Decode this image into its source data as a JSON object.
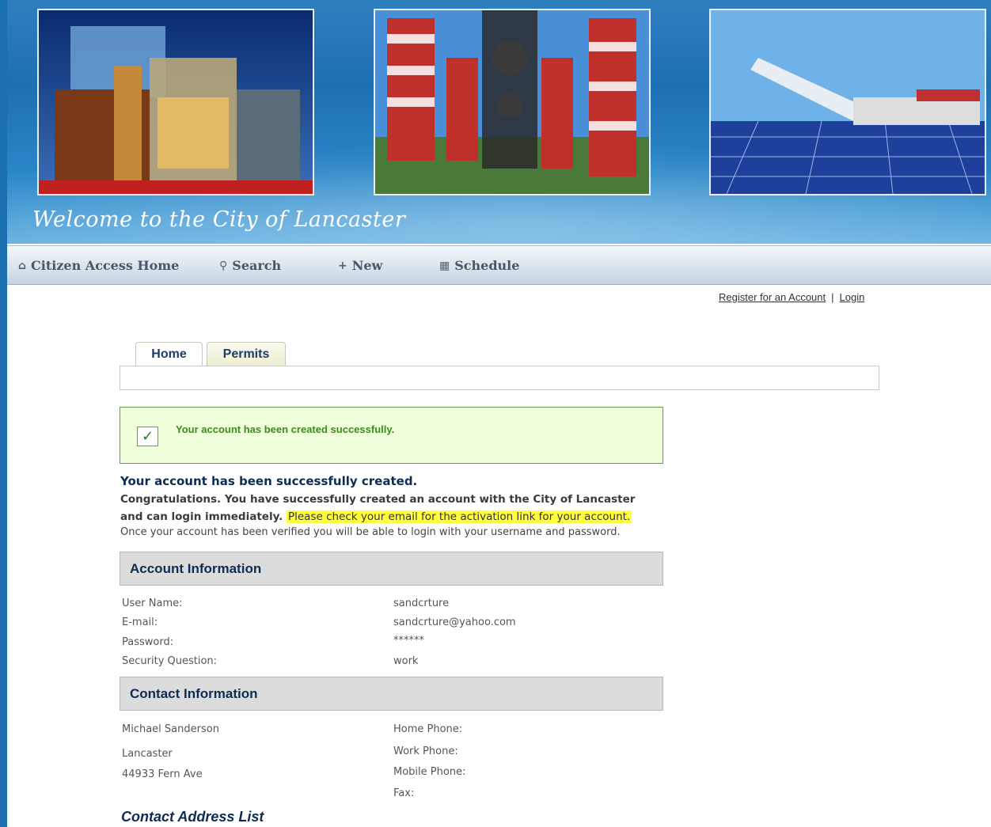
{
  "banner": {
    "welcome_text": "Welcome to the City of Lancaster"
  },
  "nav": {
    "items": [
      {
        "label": "Citizen Access Home",
        "icon": "home-icon"
      },
      {
        "label": "Search",
        "icon": "search-icon"
      },
      {
        "label": "New",
        "icon": "plus-icon"
      },
      {
        "label": "Schedule",
        "icon": "calendar-icon"
      }
    ]
  },
  "top_links": {
    "register": "Register for an Account",
    "separator": "|",
    "login": "Login"
  },
  "tabs": [
    {
      "label": "Home"
    },
    {
      "label": "Permits"
    }
  ],
  "success_box": {
    "message": "Your account has been created successfully."
  },
  "intro": {
    "heading": "Your account has been successfully created.",
    "congrats": "Congratulations. You have successfully created an account with the City of Lancaster and can login immediately.",
    "highlight": "Please check your email for the activation link for your account.",
    "verify": "Once your account has been verified you will be able to login with your username and password."
  },
  "account_info": {
    "title": "Account Information",
    "rows": [
      {
        "label": "User Name:",
        "value": "sandcrture"
      },
      {
        "label": "E-mail:",
        "value": "sandcrture@yahoo.com"
      },
      {
        "label": "Password:",
        "value": "******"
      },
      {
        "label": "Security Question:",
        "value": "work"
      }
    ]
  },
  "contact_info": {
    "title": "Contact Information",
    "name": "Michael Sanderson",
    "city": "Lancaster",
    "street": "44933 Fern Ave",
    "phones": [
      {
        "label": "Home Phone:"
      },
      {
        "label": "Work Phone:"
      },
      {
        "label": "Mobile Phone:"
      },
      {
        "label": "Fax:"
      }
    ]
  },
  "address_list": {
    "title": "Contact Address List"
  },
  "colors": {
    "accent": "#0e2c52",
    "success_bg": "#eeffda",
    "success_border": "#5ba33f",
    "highlight": "#ffff3b"
  }
}
